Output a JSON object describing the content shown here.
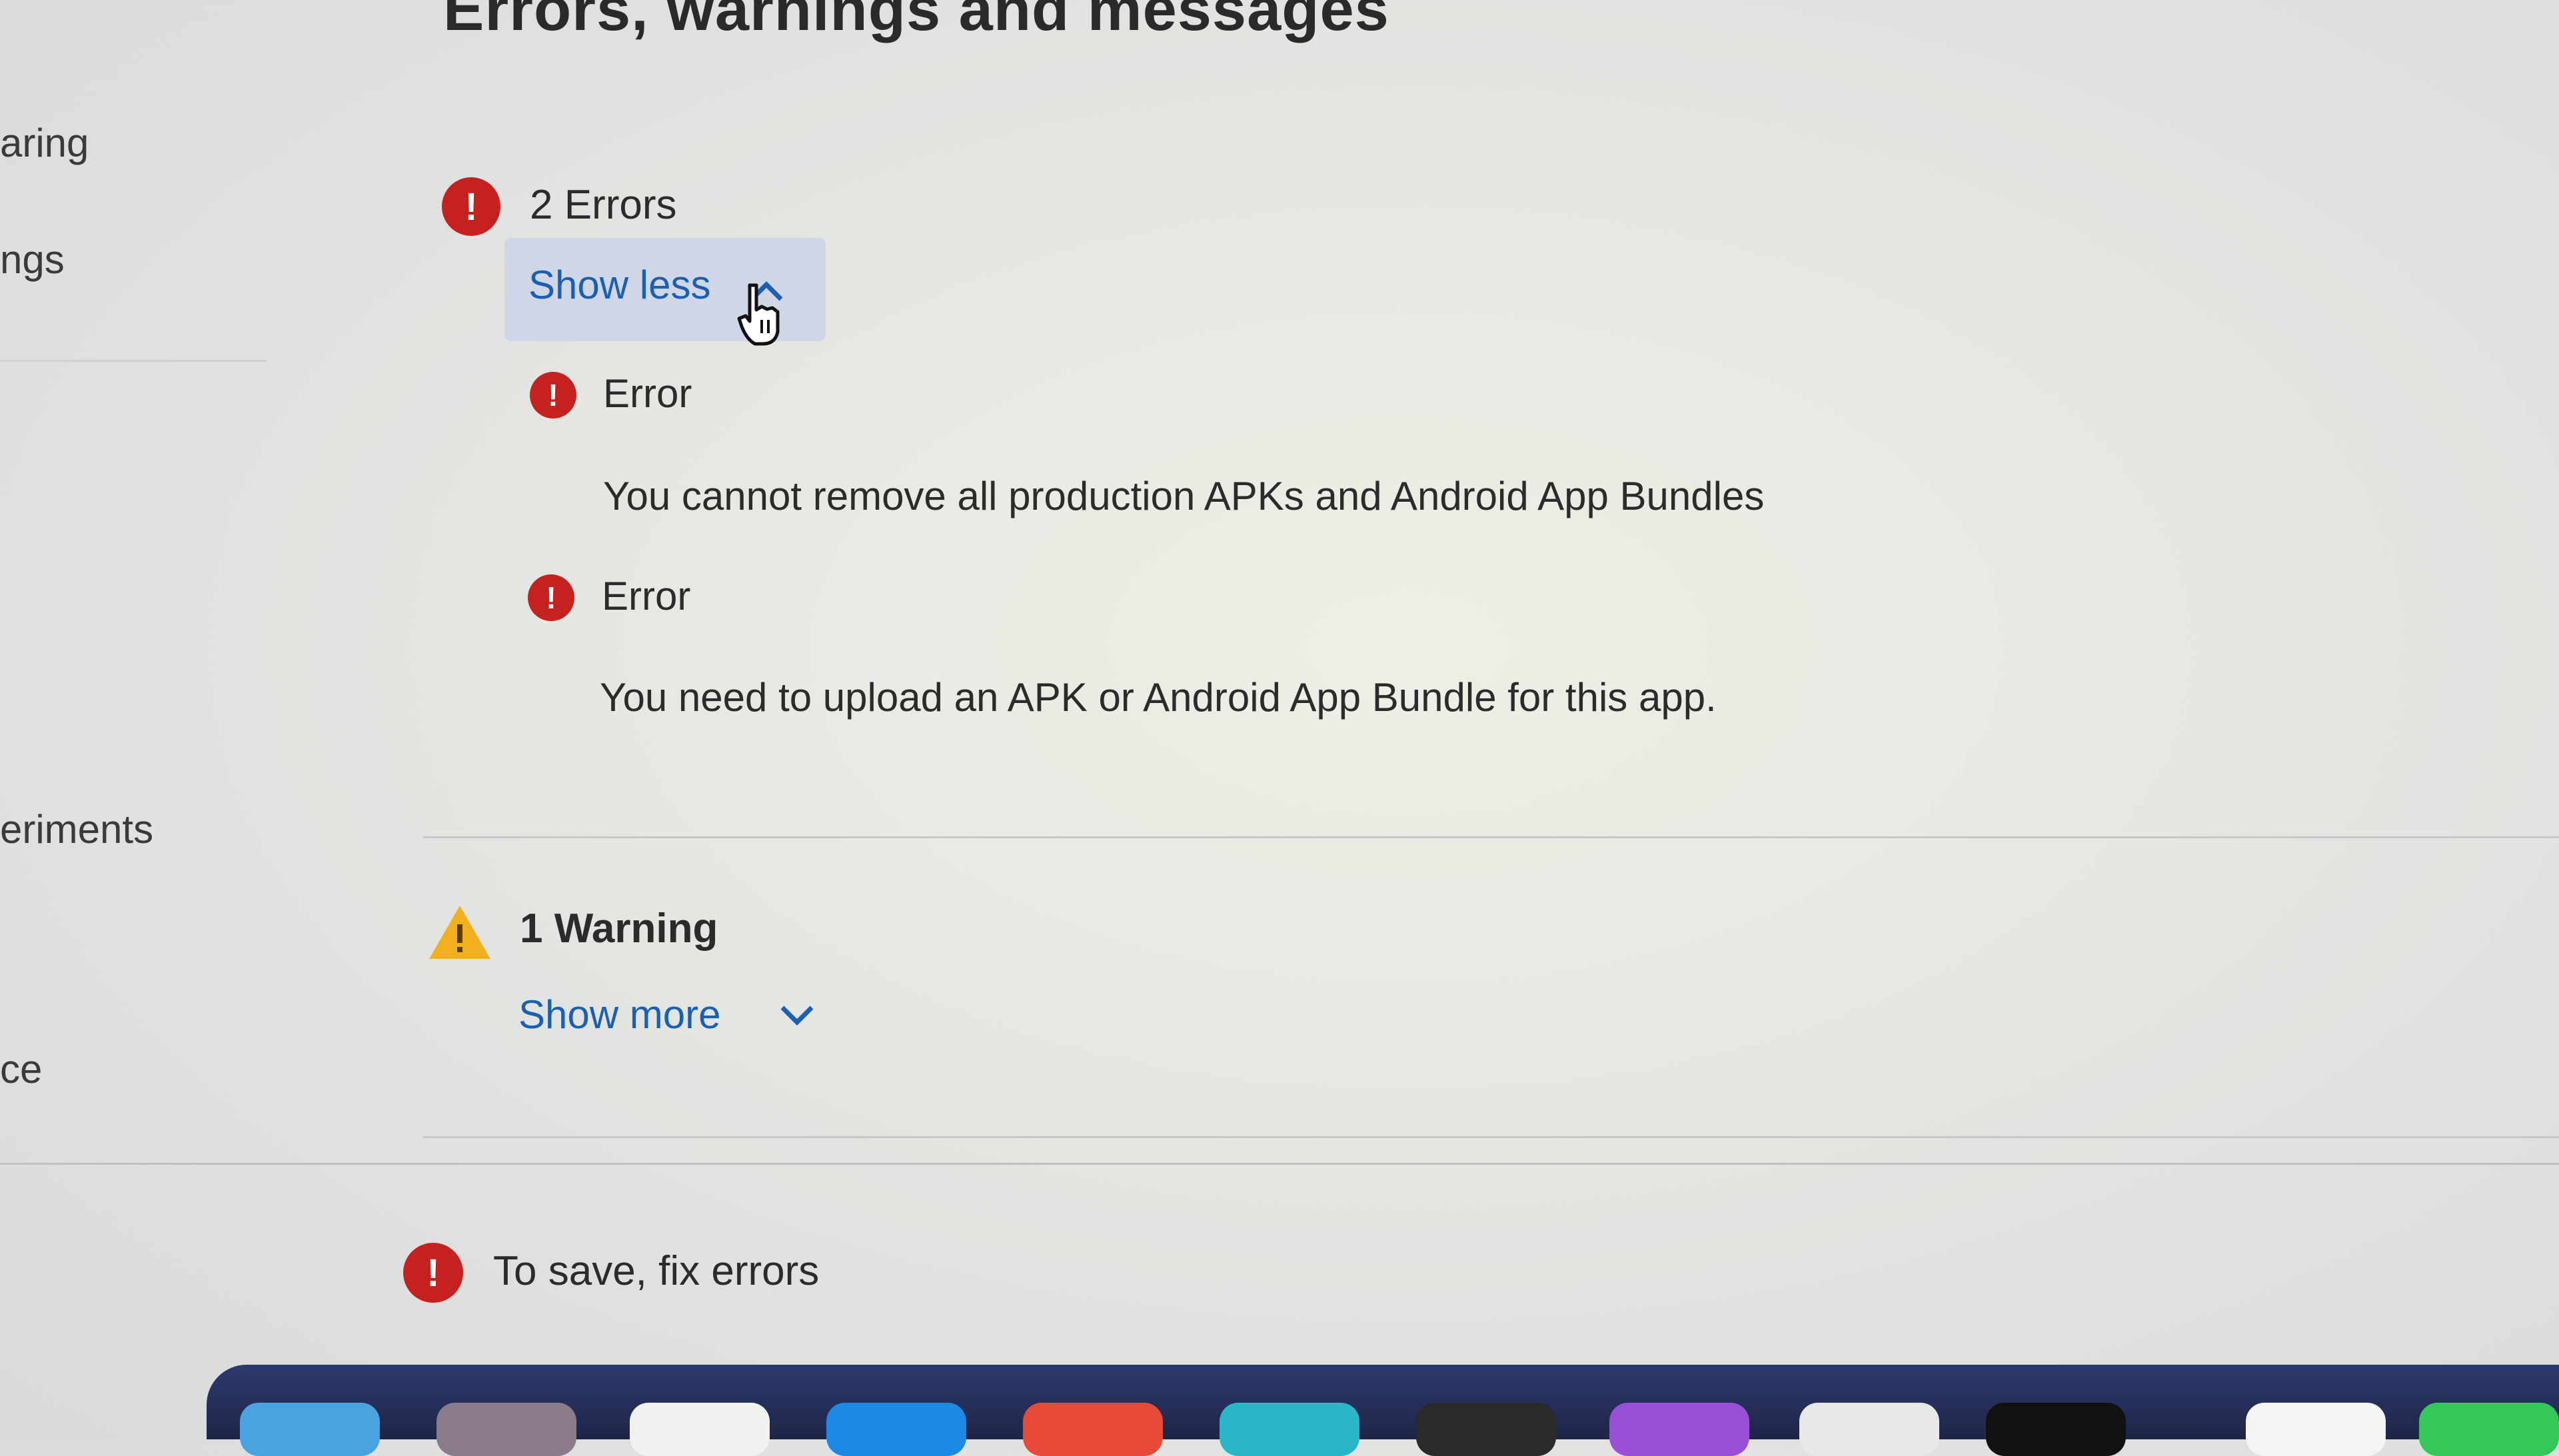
{
  "sidebar": {
    "items": [
      "aring",
      "ngs",
      "eriments",
      "ce"
    ]
  },
  "main": {
    "title": "Errors, warnings and messages",
    "errors": {
      "count_label": "2 Errors",
      "toggle_label": "Show less",
      "items": [
        {
          "label": "Error",
          "message": "You cannot remove all production APKs and Android App Bundles"
        },
        {
          "label": "Error",
          "message": "You need to upload an APK or Android App Bundle for this app."
        }
      ]
    },
    "warnings": {
      "count_label": "1 Warning",
      "toggle_label": "Show more"
    }
  },
  "footer": {
    "status": "To save, fix errors"
  },
  "icons": {
    "error": "exclamation-circle-icon",
    "warning": "warning-triangle-icon",
    "chevron_up": "chevron-up-icon",
    "chevron_down": "chevron-down-icon",
    "cursor": "hand-pointer-icon"
  },
  "colors": {
    "error": "#c5221f",
    "warning": "#f2b01e",
    "link": "#1a5fb4",
    "toggle_bg": "#cfd6e6",
    "dock": "#1d2547"
  }
}
